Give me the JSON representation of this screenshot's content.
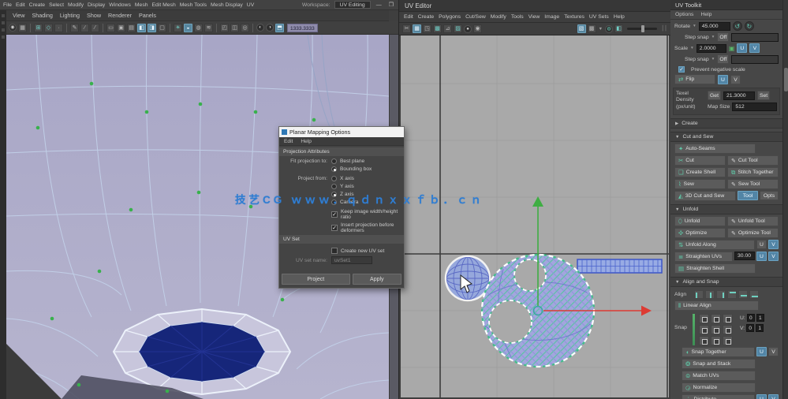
{
  "chrome": {
    "workspace_label": "Workspace:",
    "workspace_value": "UV Editing",
    "minimize": "—",
    "restore": "❐"
  },
  "main_menu": {
    "items": [
      "File",
      "Edit",
      "Create",
      "Select",
      "Modify",
      "Display",
      "Windows",
      "Mesh",
      "Edit Mesh",
      "Mesh Tools",
      "Mesh Display",
      "UV"
    ]
  },
  "viewport": {
    "panel_menus": [
      "View",
      "Shading",
      "Lighting",
      "Show",
      "Renderer",
      "Panels"
    ],
    "toolbar_field": "1333.3333"
  },
  "dialog": {
    "title": "Planar Mapping Options",
    "menus": [
      "Edit",
      "Help"
    ],
    "section_projection": "Projection Attributes",
    "fit_label": "Fit projection to:",
    "fit_options": [
      {
        "label": "Best plane",
        "selected": false
      },
      {
        "label": "Bounding box",
        "selected": true
      }
    ],
    "from_label": "Project from:",
    "from_options": [
      {
        "label": "X axis",
        "selected": false
      },
      {
        "label": "Y axis",
        "selected": false
      },
      {
        "label": "Z axis",
        "selected": true
      },
      {
        "label": "Camera",
        "selected": false
      }
    ],
    "keep_ratio": "Keep image width/height ratio",
    "keep_ratio_checked": true,
    "insert_before": "Insert projection before deformers",
    "insert_before_checked": true,
    "section_uvset": "UV Set",
    "create_uvset": "Create new UV set",
    "create_uvset_checked": false,
    "uvset_name_label": "UV set name:",
    "uvset_name_value": "uvSet1",
    "project_btn": "Project",
    "apply_btn": "Apply"
  },
  "uv_editor": {
    "title": "UV Editor",
    "menus": [
      "Edit",
      "Create",
      "Polygons",
      "Cut/Sew",
      "Modify",
      "Tools",
      "View",
      "Image",
      "Textures",
      "UV Sets",
      "Help"
    ]
  },
  "toolkit": {
    "title": "UV Toolkit",
    "menus": [
      "Options",
      "Help"
    ],
    "transform": {
      "rotate_label": "Rotate",
      "rotate_value": "45.000",
      "step_snap_label": "Step snap",
      "step_snap_value": "Off",
      "scale_label": "Scale",
      "scale_value": "2.0000",
      "step_snap2_value": "Off",
      "prevent_negative": "Prevent negative scale",
      "flip_label": "Flip",
      "u": "U",
      "v": "V",
      "texel_label": "Texel Density (px/unit)",
      "get_btn": "Get",
      "texel_value": "21.3000",
      "set_btn": "Set",
      "map_size_label": "Map Size",
      "map_size_value": "512"
    },
    "sections": {
      "create": "Create",
      "cut_sew": "Cut and Sew",
      "unfold": "Unfold",
      "align_snap": "Align and Snap"
    },
    "cut_sew": {
      "auto_seams": "Auto-Seams",
      "cut": "Cut",
      "cut_tool": "Cut Tool",
      "create_shell": "Create Shell",
      "stitch_together": "Stitch Together",
      "sew": "Sew",
      "sew_tool": "Sew Tool",
      "cut3d": "3D Cut and Sew",
      "tool_btn": "Tool",
      "opts_btn": "Opts"
    },
    "unfold": {
      "unfold": "Unfold",
      "unfold_tool": "Unfold Tool",
      "optimize": "Optimize",
      "optimize_tool": "Optimize Tool",
      "unfold_along": "Unfold Along",
      "straighten_uvs": "Straighten UVs",
      "straighten_angle": "30.00",
      "straighten_shell": "Straighten Shell"
    },
    "align": {
      "align_label": "Align",
      "linear_align": "Linear Align",
      "snap_label": "Snap",
      "u_label": "U:",
      "v_label": "V:",
      "u0": "0",
      "u1": "1",
      "v0": "0",
      "v1": "1",
      "snap_together": "Snap Together",
      "snap_stack": "Snap and Stack",
      "match_uvs": "Match UVs",
      "normalize": "Normalize",
      "distribute": "Distribute"
    }
  },
  "watermark": "技艺CG ｗｗｗ．ｑｄｎｘｘｆｂ．ｃｎ",
  "colors": {
    "accent_blue": "#5285a6",
    "teal_icon": "#5fc9a8",
    "selection_green": "#3fae4f",
    "manip_green": "#3fae43",
    "manip_red": "#dd3b33",
    "shell_fill": "#a2a6dd",
    "shell_wire_teal": "#57c7a0",
    "navy_faces": "#16267a",
    "canvas_gray": "#a9a9a9",
    "viewport_lavender": "#aba9c8"
  }
}
